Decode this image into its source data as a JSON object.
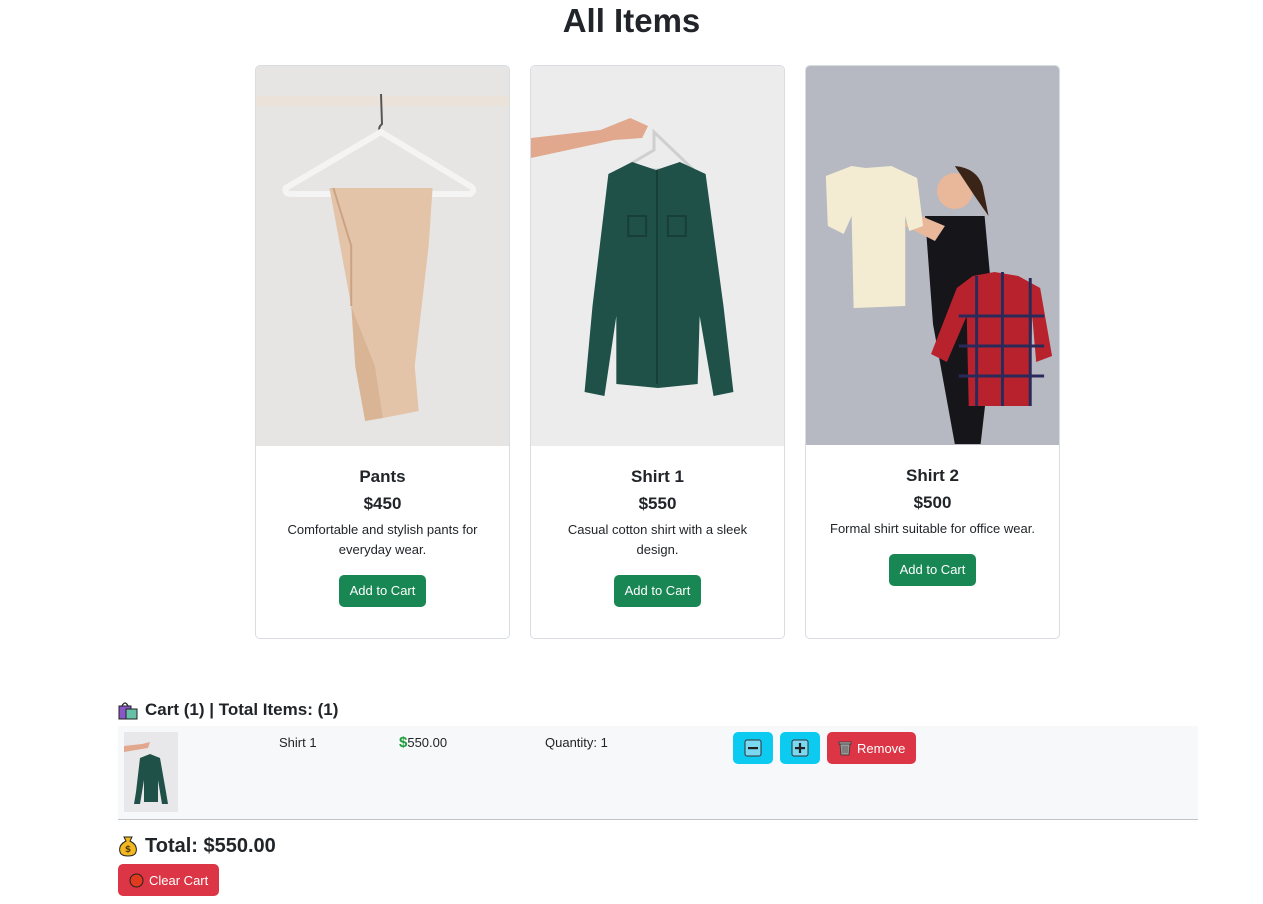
{
  "page": {
    "title": "All Items"
  },
  "products": [
    {
      "name": "Pants",
      "price": "$450",
      "description": "Comfortable and stylish pants for everyday wear.",
      "button": "Add to Cart",
      "image": "pants-photo"
    },
    {
      "name": "Shirt 1",
      "price": "$550",
      "description": "Casual cotton shirt with a sleek design.",
      "button": "Add to Cart",
      "image": "green-shirt-photo"
    },
    {
      "name": "Shirt 2",
      "price": "$500",
      "description": "Formal shirt suitable for office wear.",
      "button": "Add to Cart",
      "image": "woman-with-shirts-photo"
    }
  ],
  "cart": {
    "header": "Cart (1) | Total Items: (1)",
    "header_icon": "shopping-bags-icon",
    "items": [
      {
        "name": "Shirt 1",
        "price": "550.00",
        "price_icon": "dollar-icon",
        "quantity": "Quantity: 1",
        "image": "green-shirt-photo"
      }
    ],
    "decrement_icon": "minus-icon",
    "increment_icon": "plus-icon",
    "remove_label": "Remove",
    "remove_icon": "trash-icon",
    "total": "Total: $550.00",
    "total_icon": "money-bag-icon",
    "clear_label": "Clear Cart",
    "clear_icon": "red-circle-icon"
  },
  "colors": {
    "success": "#198754",
    "info": "#0dcaf0",
    "danger": "#dc3545",
    "row_bg": "#f7f8f9"
  }
}
